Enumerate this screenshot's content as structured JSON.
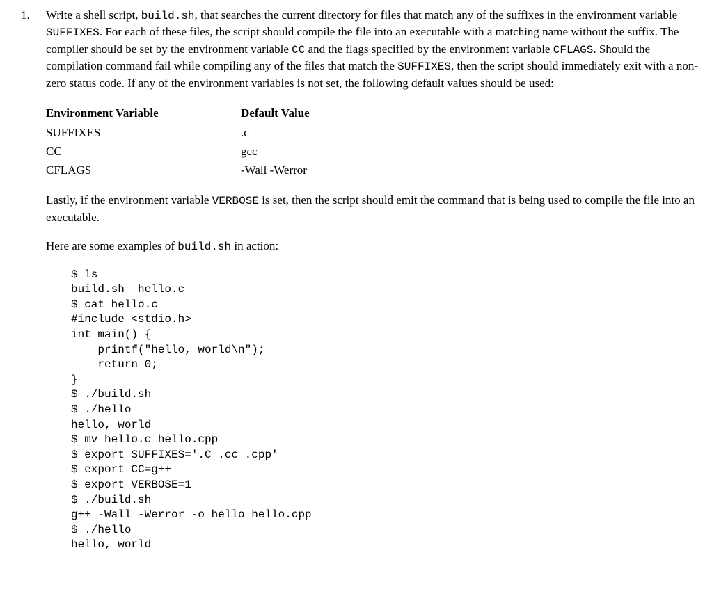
{
  "question_number": "1.",
  "paragraph1_parts": {
    "p1": "Write a shell script, ",
    "c1": "build.sh",
    "p2": ", that searches the current directory for files that match any of the suffixes in the environment variable ",
    "c2": "SUFFIXES",
    "p3": ". For each of these files, the script should compile the file into an executable with a matching name without the suffix. The compiler should be set by the environment variable ",
    "c3": "CC",
    "p4": " and the flags specified by the environment variable ",
    "c4": "CFLAGS",
    "p5": ". Should the compilation command fail while compiling any of the files that match the ",
    "c5": "SUFFIXES",
    "p6": ", then the script should immediately exit with a non-zero status code. If any of the environment variables is not set, the following default values should be used:"
  },
  "env_header": {
    "col1": "Environment Variable",
    "col2": "Default Value"
  },
  "env_rows": [
    {
      "name": "SUFFIXES",
      "default": ".c"
    },
    {
      "name": "CC",
      "default": "gcc"
    },
    {
      "name": "CFLAGS",
      "default": "-Wall -Werror"
    }
  ],
  "paragraph2_parts": {
    "p1": "Lastly, if the environment variable ",
    "c1": "VERBOSE",
    "p2": " is set, then the script should emit the command that is being used to compile the file into an executable."
  },
  "paragraph3_parts": {
    "p1": "Here are some examples of ",
    "c1": "build.sh",
    "p2": " in action:"
  },
  "code_example": "$ ls\nbuild.sh  hello.c\n$ cat hello.c\n#include <stdio.h>\nint main() {\n    printf(\"hello, world\\n\");\n    return 0;\n}\n$ ./build.sh\n$ ./hello\nhello, world\n$ mv hello.c hello.cpp\n$ export SUFFIXES='.C .cc .cpp'\n$ export CC=g++\n$ export VERBOSE=1\n$ ./build.sh\ng++ -Wall -Werror -o hello hello.cpp\n$ ./hello\nhello, world"
}
